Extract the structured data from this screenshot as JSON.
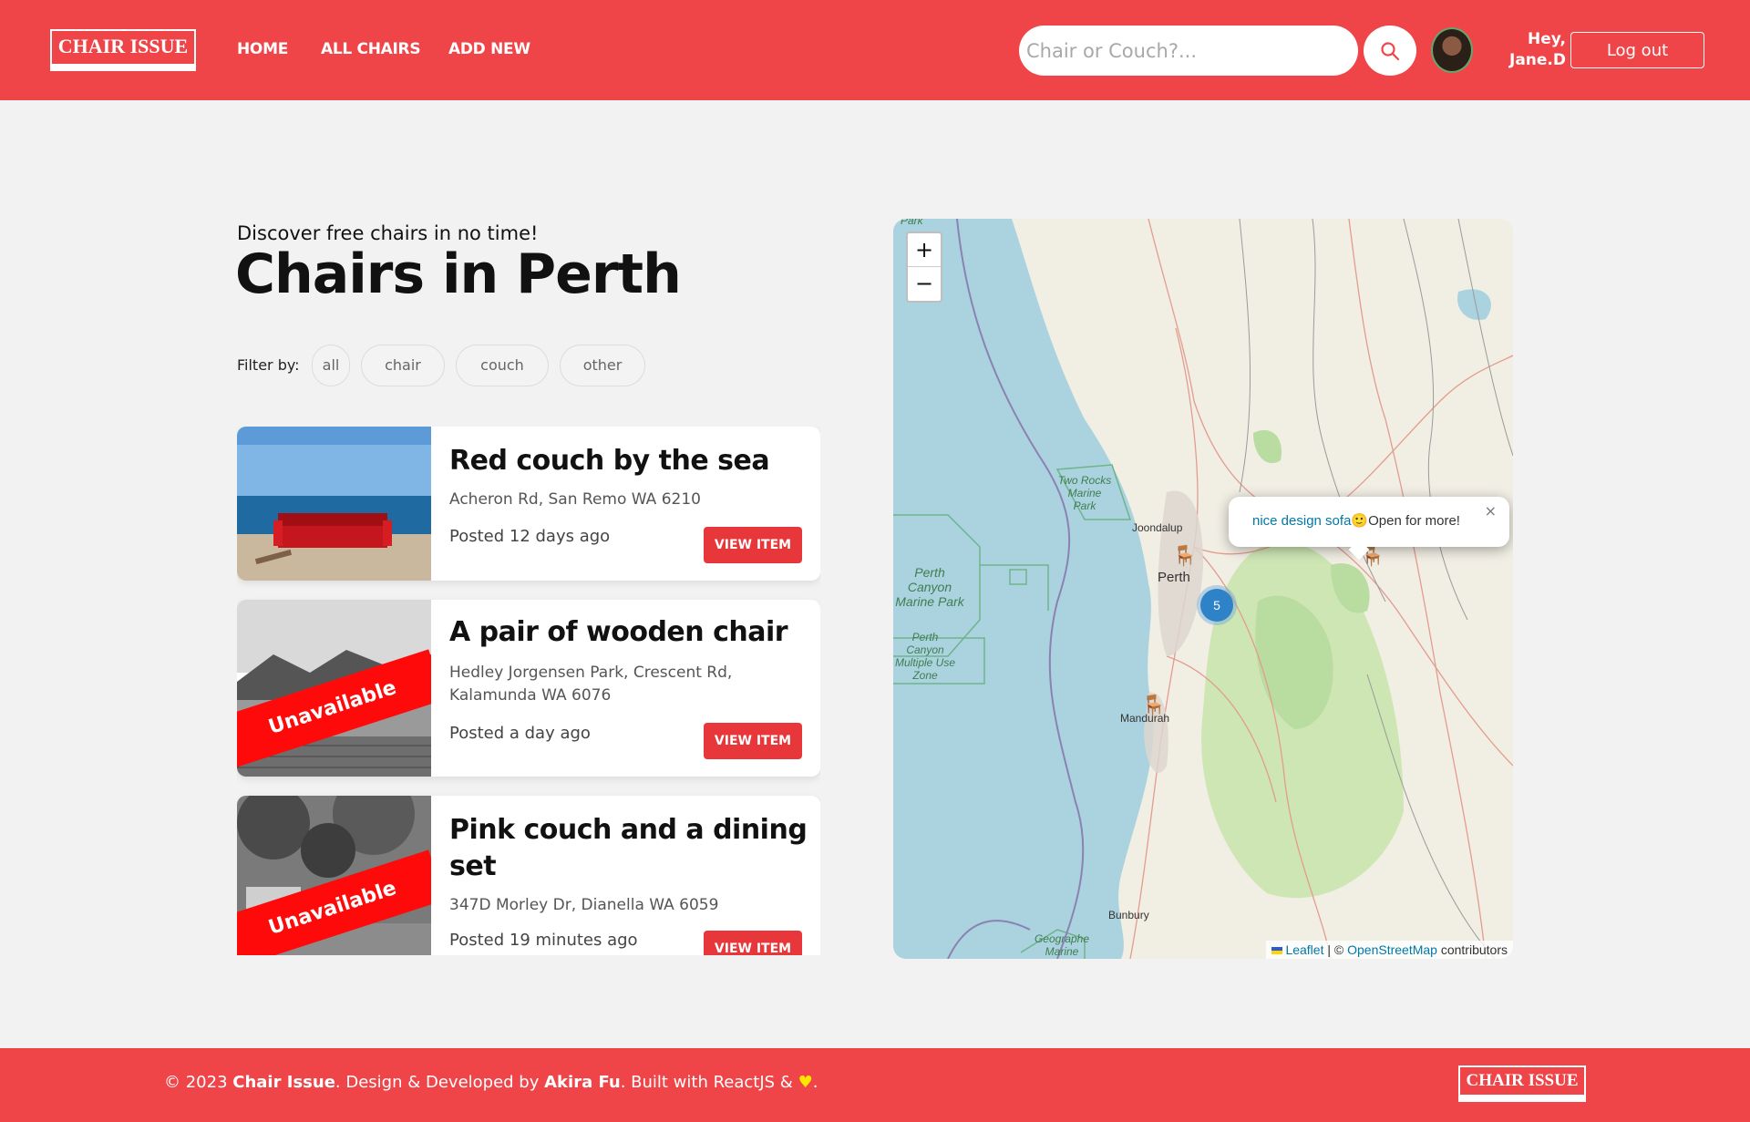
{
  "header": {
    "logo": "CHAIR ISSUE",
    "nav": [
      "HOME",
      "ALL CHAIRS",
      "ADD NEW"
    ],
    "search_placeholder": "Chair or Couch?...",
    "greeting_line1": "Hey,",
    "greeting_line2": "Jane.D",
    "logout_label": "Log out"
  },
  "intro": {
    "eyebrow": "Discover free chairs in no time!",
    "title": "Chairs in Perth"
  },
  "filters": {
    "label": "Filter by:",
    "options": [
      "all",
      "chair",
      "couch",
      "other"
    ]
  },
  "listings": [
    {
      "title": "Red couch by the sea",
      "address": "Acheron Rd, San Remo WA 6210",
      "posted": "Posted 12 days ago",
      "button": "VIEW ITEM",
      "status": ""
    },
    {
      "title": "A pair of wooden chair",
      "address": "Hedley Jorgensen Park, Crescent Rd, Kalamunda WA 6076",
      "posted": "Posted a day ago",
      "button": "VIEW ITEM",
      "status": "Unavailable"
    },
    {
      "title": "Pink couch and a dining set",
      "address": "347D Morley Dr, Dianella WA 6059",
      "posted": "Posted 19 minutes ago",
      "button": "VIEW ITEM",
      "status": "Unavailable"
    }
  ],
  "map": {
    "zoom_in": "+",
    "zoom_out": "−",
    "popup_link": "nice design sofa",
    "popup_text": "Open for more!",
    "popup_close": "×",
    "cluster_count": "5",
    "places": {
      "park": "Park",
      "two_rocks": "Two Rocks Marine Park",
      "joondalup": "Joondalup",
      "perth": "Perth",
      "perth_canyon": "Perth Canyon Marine Park",
      "perth_canyon_multi": "Perth Canyon Multiple Use Zone",
      "mandurah": "Mandurah",
      "bunbury": "Bunbury",
      "geographe": "Geographe Marine"
    },
    "attribution_leaflet": "Leaflet",
    "attribution_sep": "| ©",
    "attribution_osm": "OpenStreetMap",
    "attribution_tail": "contributors"
  },
  "footer": {
    "copyright": "© 2023",
    "brand": "Chair Issue",
    "mid": ". Design & Developed by",
    "author": "Akira Fu",
    "tail": ". Built with ReactJS &",
    "end": ".",
    "logo": "CHAIR ISSUE"
  },
  "colors": {
    "brand": "#ef4548",
    "button": "#e8373a",
    "ribbon": "#ff0a0a",
    "cluster": "#2d82c8"
  }
}
